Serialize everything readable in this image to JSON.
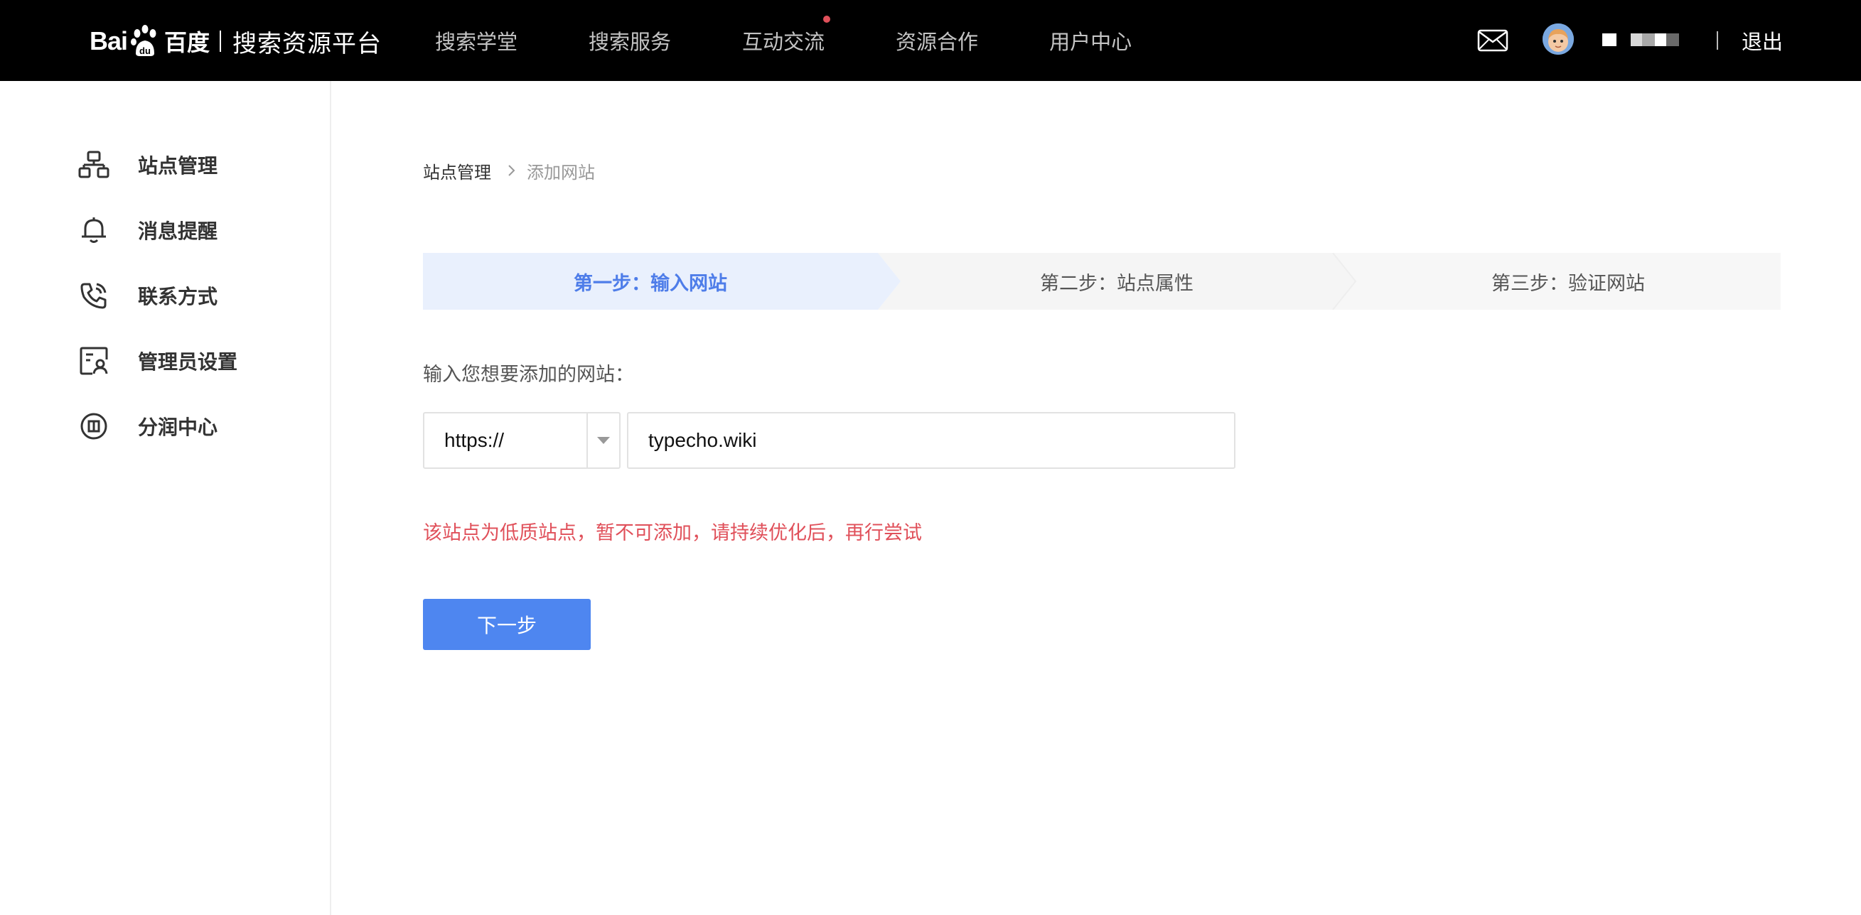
{
  "brand": {
    "logo_text_left": "Bai",
    "logo_text_cn": "百度",
    "platform_name": "搜索资源平台"
  },
  "top_nav": {
    "items": [
      {
        "label": "搜索学堂"
      },
      {
        "label": "搜索服务"
      },
      {
        "label": "互动交流",
        "has_dot": true
      },
      {
        "label": "资源合作"
      },
      {
        "label": "用户中心"
      }
    ],
    "logout_label": "退出"
  },
  "sidebar": {
    "items": [
      {
        "label": "站点管理",
        "icon": "site-tree-icon"
      },
      {
        "label": "消息提醒",
        "icon": "bell-icon"
      },
      {
        "label": "联系方式",
        "icon": "phone-icon"
      },
      {
        "label": "管理员设置",
        "icon": "admin-card-icon"
      },
      {
        "label": "分润中心",
        "icon": "revenue-circle-icon"
      }
    ]
  },
  "breadcrumb": {
    "root": "站点管理",
    "current": "添加网站"
  },
  "steps": [
    {
      "label": "第一步：输入网站",
      "state": "active"
    },
    {
      "label": "第二步：站点属性",
      "state": "inactive"
    },
    {
      "label": "第三步：验证网站",
      "state": "inactive"
    }
  ],
  "form": {
    "label": "输入您想要添加的网站：",
    "protocol_selected": "https://",
    "url_value": "typecho.wiki",
    "error_message": "该站点为低质站点，暂不可添加，请持续优化后，再行尝试",
    "next_button_label": "下一步"
  },
  "colors": {
    "header_bg": "#000000",
    "accent": "#4e86f0",
    "active_step_bg": "#e9f0fd",
    "inactive_step_bg": "#f7f7f7",
    "error": "#e0505a"
  }
}
